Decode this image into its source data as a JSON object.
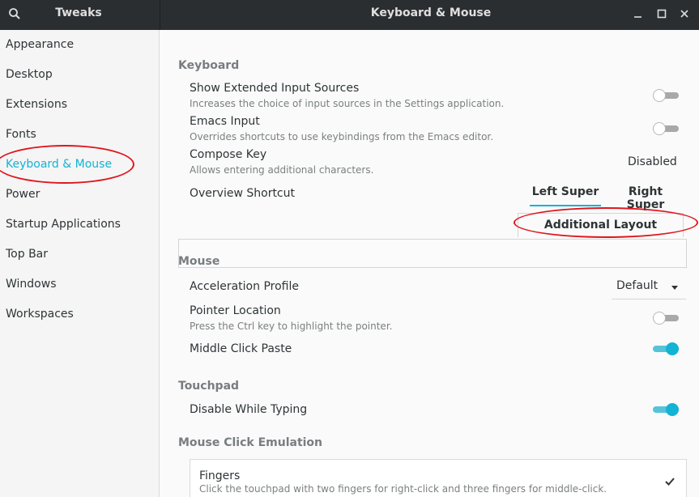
{
  "header": {
    "app_title": "Tweaks",
    "page_title": "Keyboard & Mouse",
    "icons": [
      "search-icon",
      "minimize-icon",
      "maximize-icon",
      "close-icon"
    ]
  },
  "sidebar": {
    "items": [
      {
        "label": "Appearance"
      },
      {
        "label": "Desktop"
      },
      {
        "label": "Extensions"
      },
      {
        "label": "Fonts"
      },
      {
        "label": "Keyboard & Mouse",
        "active": true
      },
      {
        "label": "Power"
      },
      {
        "label": "Startup Applications"
      },
      {
        "label": "Top Bar"
      },
      {
        "label": "Windows"
      },
      {
        "label": "Workspaces"
      }
    ]
  },
  "keyboard": {
    "heading": "Keyboard",
    "extended_sources": {
      "label": "Show Extended Input Sources",
      "desc": "Increases the choice of input sources in the Settings application.",
      "enabled": false
    },
    "emacs": {
      "label": "Emacs Input",
      "desc": "Overrides shortcuts to use keybindings from the Emacs editor.",
      "enabled": false
    },
    "compose": {
      "label": "Compose Key",
      "desc": "Allows entering additional characters.",
      "value": "Disabled"
    },
    "overview": {
      "label": "Overview Shortcut",
      "options": [
        "Left Super",
        "Right Super"
      ],
      "selected": "Left Super"
    },
    "additional_button": "Additional Layout Options"
  },
  "mouse": {
    "heading": "Mouse",
    "accel": {
      "label": "Acceleration Profile",
      "value": "Default"
    },
    "pointer": {
      "label": "Pointer Location",
      "desc": "Press the Ctrl key to highlight the pointer.",
      "enabled": false
    },
    "middle_click": {
      "label": "Middle Click Paste",
      "enabled": true
    }
  },
  "touchpad": {
    "heading": "Touchpad",
    "disable_typing": {
      "label": "Disable While Typing",
      "enabled": true
    }
  },
  "click_emulation": {
    "heading": "Mouse Click Emulation",
    "fingers": {
      "label": "Fingers",
      "desc": "Click the touchpad with two fingers for right-click and three fingers for middle-click.",
      "selected": true
    }
  },
  "colors": {
    "accent": "#13b3d4",
    "header_bg": "#2b2e31",
    "annotation": "#e0161e"
  }
}
